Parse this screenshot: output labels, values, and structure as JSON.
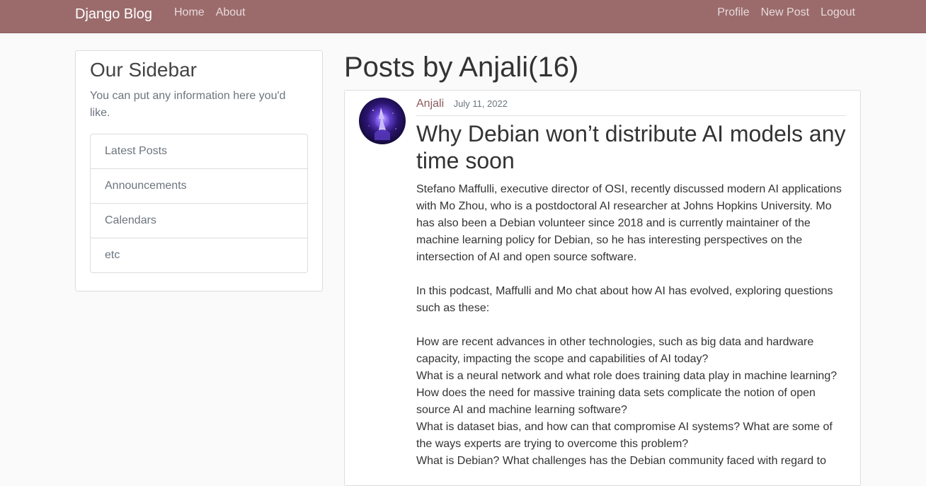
{
  "navbar": {
    "brand": "Django Blog",
    "left_links": [
      "Home",
      "About"
    ],
    "right_links": [
      "Profile",
      "New Post",
      "Logout"
    ],
    "colors": {
      "background": "#9b6b6c",
      "link": "#e8dada"
    }
  },
  "sidebar": {
    "title": "Our Sidebar",
    "text": "You can put any information here you'd like.",
    "items": [
      "Latest Posts",
      "Announcements",
      "Calendars",
      "etc"
    ]
  },
  "main": {
    "page_title": "Posts by Anjali(16)",
    "post": {
      "author": "Anjali",
      "date": "July 11, 2022",
      "title": "Why Debian won’t distribute AI models any time soon",
      "content": "Stefano Maffulli, executive director of OSI, recently discussed modern AI applications with Mo Zhou, who is a postdoctoral AI researcher at Johns Hopkins University. Mo has also been a Debian volunteer since 2018 and is currently maintainer of the machine learning policy for Debian, so he has interesting perspectives on the intersection of AI and open source software.\n\nIn this podcast, Maffulli and Mo chat about how AI has evolved, exploring questions such as these:\n\nHow are recent advances in other technologies, such as big data and hardware capacity, impacting the scope and capabilities of AI today?\nWhat is a neural network and what role does training data play in machine learning?\nHow does the need for massive training data sets complicate the notion of open source AI and machine learning software?\nWhat is dataset bias, and how can that compromise AI systems? What are some of the ways experts are trying to overcome this problem?\nWhat is Debian? What challenges has the Debian community faced with regard to",
      "avatar_icon": "user-avatar-image"
    }
  }
}
